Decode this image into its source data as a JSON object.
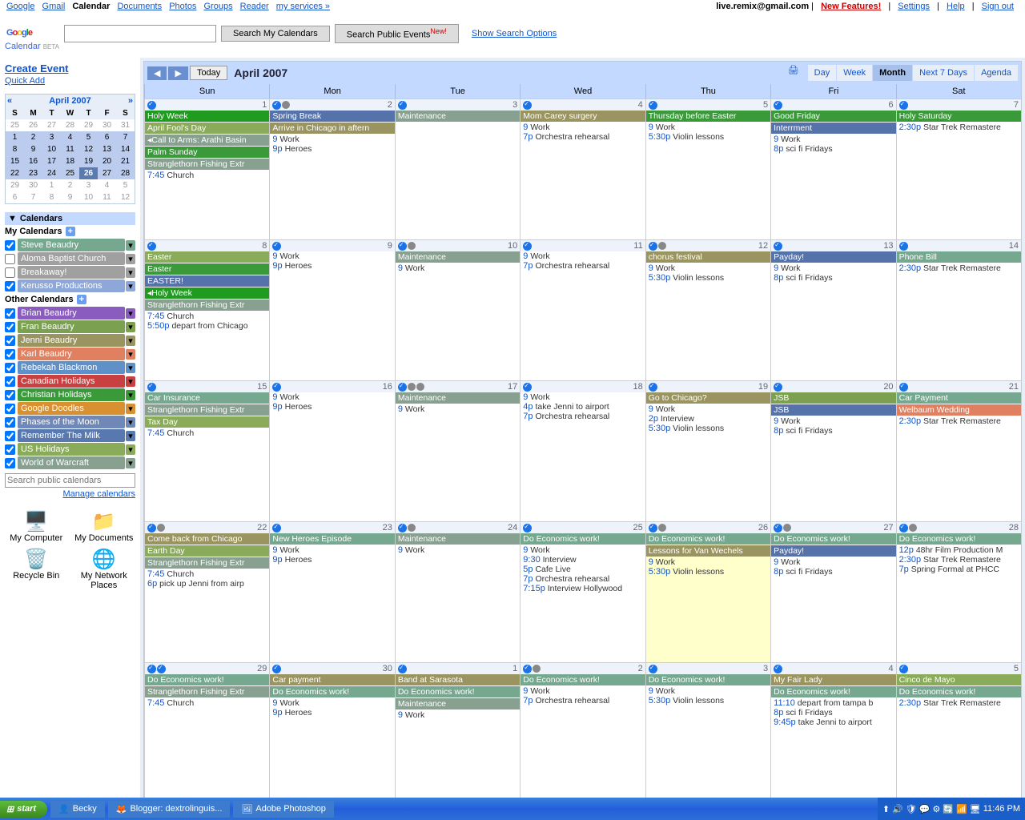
{
  "top_links": {
    "google": "Google",
    "gmail": "Gmail",
    "calendar": "Calendar",
    "documents": "Documents",
    "photos": "Photos",
    "groups": "Groups",
    "reader": "Reader",
    "more": "my services »"
  },
  "top_right": {
    "email": "live.remix@gmail.com",
    "new_features": "New Features!",
    "settings": "Settings",
    "help": "Help",
    "signout": "Sign out"
  },
  "logo_sub": "Calendar",
  "beta": "BETA",
  "search_my": "Search My Calendars",
  "search_public": "Search Public Events",
  "new_tag": "New!",
  "search_options": "Show Search Options",
  "create_event": "Create Event",
  "quick_add": "Quick Add",
  "mini": {
    "title": "April 2007",
    "dow": [
      "S",
      "M",
      "T",
      "W",
      "T",
      "F",
      "S"
    ],
    "rows": [
      [
        "25",
        "26",
        "27",
        "28",
        "29",
        "30",
        "31"
      ],
      [
        "1",
        "2",
        "3",
        "4",
        "5",
        "6",
        "7"
      ],
      [
        "8",
        "9",
        "10",
        "11",
        "12",
        "13",
        "14"
      ],
      [
        "15",
        "16",
        "17",
        "18",
        "19",
        "20",
        "21"
      ],
      [
        "22",
        "23",
        "24",
        "25",
        "26",
        "27",
        "28"
      ],
      [
        "29",
        "30",
        "1",
        "2",
        "3",
        "4",
        "5"
      ],
      [
        "6",
        "7",
        "8",
        "9",
        "10",
        "11",
        "12"
      ]
    ],
    "prev_other": [
      0
    ],
    "next_other": [
      5,
      6
    ],
    "today": [
      4,
      4
    ]
  },
  "calendars_hdr": "Calendars",
  "my_cal_hdr": "My Calendars",
  "my_cals": [
    {
      "label": "Steve Beaudry",
      "color": "#76a890",
      "checked": true
    },
    {
      "label": "Aloma Baptist Church",
      "color": "#a0a0a0",
      "checked": false
    },
    {
      "label": "Breakaway!",
      "color": "#a0a0a0",
      "checked": false
    },
    {
      "label": "Kerusso Productions",
      "color": "#8da8d8",
      "checked": true
    }
  ],
  "other_cal_hdr": "Other Calendars",
  "other_cals": [
    {
      "label": "Brian Beaudry",
      "color": "#8a5cc0",
      "checked": true
    },
    {
      "label": "Fran Beaudry",
      "color": "#7aa050",
      "checked": true
    },
    {
      "label": "Jenni Beaudry",
      "color": "#9a9560",
      "checked": true
    },
    {
      "label": "Karl Beaudry",
      "color": "#e08060",
      "checked": true
    },
    {
      "label": "Rebekah Blackmon",
      "color": "#6090c8",
      "checked": true
    },
    {
      "label": "Canadian Holidays",
      "color": "#c84040",
      "checked": true
    },
    {
      "label": "Christian Holidays",
      "color": "#3a9a3a",
      "checked": true
    },
    {
      "label": "Google Doodles",
      "color": "#d89030",
      "checked": true
    },
    {
      "label": "Phases of the Moon",
      "color": "#7088b8",
      "checked": true
    },
    {
      "label": "Remember The Milk",
      "color": "#5878b0",
      "checked": true
    },
    {
      "label": "US Holidays",
      "color": "#8aab5a",
      "checked": true
    },
    {
      "label": "World of Warcraft",
      "color": "#88a090",
      "checked": true
    }
  ],
  "search_placeholder": "Search public calendars",
  "manage": "Manage calendars",
  "desktop": {
    "mycomp": "My Computer",
    "mydocs": "My Documents",
    "recycle": "Recycle Bin",
    "netplaces": "My Network Places"
  },
  "toolbar": {
    "today": "Today",
    "title": "April 2007"
  },
  "views": {
    "day": "Day",
    "week": "Week",
    "month": "Month",
    "next7": "Next 7 Days",
    "agenda": "Agenda"
  },
  "dow": [
    "Sun",
    "Mon",
    "Tue",
    "Wed",
    "Thu",
    "Fri",
    "Sat"
  ],
  "weeks": [
    [
      {
        "n": "1",
        "icons": [
          "c"
        ],
        "evts": [
          {
            "t": "Holy Week",
            "c": "#1f9c1f",
            "span": 7
          },
          {
            "t": "April Fool's Day",
            "c": "#8aab5a"
          },
          {
            "t": "◂Call to Arms: Arathi Basin",
            "c": "#88a090"
          },
          {
            "t": "Palm Sunday",
            "c": "#3a9a3a"
          },
          {
            "t": "Stranglethorn Fishing Extr",
            "c": "#88a090"
          }
        ],
        "txts": [
          {
            "tm": "7:45",
            "t": "Church"
          }
        ]
      },
      {
        "n": "2",
        "icons": [
          "c",
          "m"
        ],
        "evts": [
          {
            "t": "Spring Break",
            "c": "#5572ab",
            "span": 5
          },
          {
            "t": "Arrive in Chicago in aftern",
            "c": "#9a9560"
          }
        ],
        "txts": [
          {
            "tm": "9",
            "t": "Work"
          },
          {
            "tm": "9p",
            "t": "Heroes"
          }
        ]
      },
      {
        "n": "3",
        "icons": [
          "c"
        ],
        "evts": [
          {
            "t": "Maintenance",
            "c": "#88a090"
          }
        ],
        "txts": []
      },
      {
        "n": "4",
        "icons": [
          "c"
        ],
        "evts": [
          {
            "t": "Mom Carey surgery",
            "c": "#9a9560"
          }
        ],
        "txts": [
          {
            "tm": "9",
            "t": "Work"
          },
          {
            "tm": "7p",
            "t": "Orchestra rehearsal"
          }
        ]
      },
      {
        "n": "5",
        "icons": [
          "c"
        ],
        "evts": [
          {
            "t": "Thursday before Easter",
            "c": "#3a9a3a"
          }
        ],
        "txts": [
          {
            "tm": "9",
            "t": "Work"
          },
          {
            "tm": "5:30p",
            "t": "Violin lessons"
          }
        ]
      },
      {
        "n": "6",
        "icons": [
          "c"
        ],
        "evts": [
          {
            "t": "Good Friday",
            "c": "#3a9a3a"
          },
          {
            "t": "Interrment",
            "c": "#5572ab"
          }
        ],
        "txts": [
          {
            "tm": "9",
            "t": "Work"
          },
          {
            "tm": "8p",
            "t": "sci fi Fridays"
          }
        ]
      },
      {
        "n": "7",
        "icons": [
          "c"
        ],
        "evts": [
          {
            "t": "Holy Saturday",
            "c": "#3a9a3a"
          }
        ],
        "txts": [
          {
            "tm": "2:30p",
            "t": "Star Trek Remastere"
          }
        ]
      }
    ],
    [
      {
        "n": "8",
        "icons": [
          "c"
        ],
        "evts": [
          {
            "t": "Easter",
            "c": "#8aab5a"
          },
          {
            "t": "Easter",
            "c": "#3a9a3a"
          },
          {
            "t": "EASTER!",
            "c": "#5572ab"
          },
          {
            "t": "◂Holy Week",
            "c": "#1f9c1f"
          },
          {
            "t": "Stranglethorn Fishing Extr",
            "c": "#88a090"
          }
        ],
        "txts": [
          {
            "tm": "7:45",
            "t": "Church"
          },
          {
            "tm": "5:50p",
            "t": "depart from Chicago"
          }
        ]
      },
      {
        "n": "9",
        "icons": [
          "c"
        ],
        "evts": [],
        "txts": [
          {
            "tm": "9",
            "t": "Work"
          },
          {
            "tm": "9p",
            "t": "Heroes"
          }
        ]
      },
      {
        "n": "10",
        "icons": [
          "c",
          "m"
        ],
        "evts": [
          {
            "t": "Maintenance",
            "c": "#88a090"
          }
        ],
        "txts": [
          {
            "tm": "9",
            "t": "Work"
          }
        ]
      },
      {
        "n": "11",
        "icons": [
          "c"
        ],
        "evts": [],
        "txts": [
          {
            "tm": "9",
            "t": "Work"
          },
          {
            "tm": "7p",
            "t": "Orchestra rehearsal"
          }
        ]
      },
      {
        "n": "12",
        "icons": [
          "c",
          "w"
        ],
        "evts": [
          {
            "t": "chorus festival",
            "c": "#9a9560"
          }
        ],
        "txts": [
          {
            "tm": "9",
            "t": "Work"
          },
          {
            "tm": "5:30p",
            "t": "Violin lessons"
          }
        ]
      },
      {
        "n": "13",
        "icons": [
          "c"
        ],
        "evts": [
          {
            "t": "Payday!",
            "c": "#5572ab"
          }
        ],
        "txts": [
          {
            "tm": "9",
            "t": "Work"
          },
          {
            "tm": "8p",
            "t": "sci fi Fridays"
          }
        ]
      },
      {
        "n": "14",
        "icons": [
          "c"
        ],
        "evts": [
          {
            "t": "Phone Bill",
            "c": "#76a890"
          }
        ],
        "txts": [
          {
            "tm": "2:30p",
            "t": "Star Trek Remastere"
          }
        ]
      }
    ],
    [
      {
        "n": "15",
        "icons": [
          "c"
        ],
        "evts": [
          {
            "t": "Car Insurance",
            "c": "#76a890"
          },
          {
            "t": "Stranglethorn Fishing Extr",
            "c": "#88a090"
          },
          {
            "t": "Tax Day",
            "c": "#8aab5a"
          }
        ],
        "txts": [
          {
            "tm": "7:45",
            "t": "Church"
          }
        ]
      },
      {
        "n": "16",
        "icons": [
          "c"
        ],
        "evts": [],
        "txts": [
          {
            "tm": "9",
            "t": "Work"
          },
          {
            "tm": "9p",
            "t": "Heroes"
          }
        ]
      },
      {
        "n": "17",
        "icons": [
          "c",
          "m",
          "m2"
        ],
        "evts": [
          {
            "t": "Maintenance",
            "c": "#88a090"
          }
        ],
        "txts": [
          {
            "tm": "9",
            "t": "Work"
          }
        ]
      },
      {
        "n": "18",
        "icons": [
          "c"
        ],
        "evts": [],
        "txts": [
          {
            "tm": "9",
            "t": "Work"
          },
          {
            "tm": "4p",
            "t": "take Jenni to airport"
          },
          {
            "tm": "7p",
            "t": "Orchestra rehearsal"
          }
        ]
      },
      {
        "n": "19",
        "icons": [
          "c"
        ],
        "evts": [
          {
            "t": "Go to Chicago?",
            "c": "#9a9560"
          }
        ],
        "txts": [
          {
            "tm": "9",
            "t": "Work"
          },
          {
            "tm": "2p",
            "t": "Interview"
          },
          {
            "tm": "5:30p",
            "t": "Violin lessons"
          }
        ]
      },
      {
        "n": "20",
        "icons": [
          "c"
        ],
        "evts": [
          {
            "t": "JSB",
            "c": "#7aa050"
          },
          {
            "t": "JSB",
            "c": "#5572ab"
          }
        ],
        "txts": [
          {
            "tm": "9",
            "t": "Work"
          },
          {
            "tm": "8p",
            "t": "sci fi Fridays"
          }
        ]
      },
      {
        "n": "21",
        "icons": [
          "c"
        ],
        "evts": [
          {
            "t": "Car Payment",
            "c": "#76a890"
          },
          {
            "t": "Welbaum Wedding",
            "c": "#e08060"
          }
        ],
        "txts": [
          {
            "tm": "2:30p",
            "t": "Star Trek Remastere"
          }
        ]
      }
    ],
    [
      {
        "n": "22",
        "icons": [
          "c",
          "d"
        ],
        "evts": [
          {
            "t": "Come back from Chicago",
            "c": "#9a9560"
          },
          {
            "t": "Earth Day",
            "c": "#8aab5a"
          },
          {
            "t": "Stranglethorn Fishing Extr",
            "c": "#88a090"
          }
        ],
        "txts": [
          {
            "tm": "7:45",
            "t": "Church"
          },
          {
            "tm": "6p",
            "t": "pick up Jenni from airp"
          }
        ]
      },
      {
        "n": "23",
        "icons": [
          "c"
        ],
        "evts": [
          {
            "t": "New Heroes Episode",
            "c": "#76a890"
          }
        ],
        "txts": [
          {
            "tm": "9",
            "t": "Work"
          },
          {
            "tm": "9p",
            "t": "Heroes"
          }
        ]
      },
      {
        "n": "24",
        "icons": [
          "c",
          "m"
        ],
        "evts": [
          {
            "t": "Maintenance",
            "c": "#88a090"
          }
        ],
        "txts": [
          {
            "tm": "9",
            "t": "Work"
          }
        ]
      },
      {
        "n": "25",
        "icons": [
          "c"
        ],
        "evts": [
          {
            "t": "Do Economics work!",
            "c": "#76a890"
          }
        ],
        "txts": [
          {
            "tm": "9",
            "t": "Work"
          },
          {
            "tm": "9:30",
            "t": "Interview"
          },
          {
            "tm": "5p",
            "t": "Cafe Live"
          },
          {
            "tm": "7p",
            "t": "Orchestra rehearsal"
          },
          {
            "tm": "7:15p",
            "t": "Interview Hollywood"
          }
        ]
      },
      {
        "n": "26",
        "today": true,
        "icons": [
          "c",
          "w"
        ],
        "evts": [
          {
            "t": "Do Economics work!",
            "c": "#76a890"
          },
          {
            "t": "Lessons for Van Wechels",
            "c": "#9a9560"
          }
        ],
        "txts": [
          {
            "tm": "9",
            "t": "Work"
          },
          {
            "tm": "5:30p",
            "t": "Violin lessons"
          }
        ]
      },
      {
        "n": "27",
        "icons": [
          "c",
          "w"
        ],
        "evts": [
          {
            "t": "Do Economics work!",
            "c": "#76a890"
          },
          {
            "t": "Payday!",
            "c": "#5572ab"
          }
        ],
        "txts": [
          {
            "tm": "9",
            "t": "Work"
          },
          {
            "tm": "8p",
            "t": "sci fi Fridays"
          }
        ]
      },
      {
        "n": "28",
        "icons": [
          "c",
          "w"
        ],
        "evts": [
          {
            "t": "Do Economics work!",
            "c": "#76a890"
          }
        ],
        "txts": [
          {
            "tm": "12p",
            "t": "48hr Film Production M"
          },
          {
            "tm": "2:30p",
            "t": "Star Trek Remastere"
          },
          {
            "tm": "7p",
            "t": "Spring Formal at PHCC"
          }
        ]
      }
    ],
    [
      {
        "n": "29",
        "icons": [
          "c",
          "c"
        ],
        "evts": [
          {
            "t": "Do Economics work!",
            "c": "#76a890"
          },
          {
            "t": "Stranglethorn Fishing Extr",
            "c": "#88a090"
          }
        ],
        "txts": [
          {
            "tm": "7:45",
            "t": "Church"
          }
        ]
      },
      {
        "n": "30",
        "icons": [
          "c"
        ],
        "evts": [
          {
            "t": "Car payment",
            "c": "#9a9560"
          },
          {
            "t": "Do Economics work!",
            "c": "#76a890"
          }
        ],
        "txts": [
          {
            "tm": "9",
            "t": "Work"
          },
          {
            "tm": "9p",
            "t": "Heroes"
          }
        ]
      },
      {
        "n": "1",
        "icons": [
          "c"
        ],
        "evts": [
          {
            "t": "Band at Sarasota",
            "c": "#9a9560"
          },
          {
            "t": "Do Economics work!",
            "c": "#76a890"
          },
          {
            "t": "Maintenance",
            "c": "#88a090"
          }
        ],
        "txts": [
          {
            "tm": "9",
            "t": "Work"
          }
        ]
      },
      {
        "n": "2",
        "icons": [
          "c",
          "m"
        ],
        "evts": [
          {
            "t": "Do Economics work!",
            "c": "#76a890"
          }
        ],
        "txts": [
          {
            "tm": "9",
            "t": "Work"
          },
          {
            "tm": "7p",
            "t": "Orchestra rehearsal"
          }
        ]
      },
      {
        "n": "3",
        "icons": [
          "c"
        ],
        "evts": [
          {
            "t": "Do Economics work!",
            "c": "#76a890"
          }
        ],
        "txts": [
          {
            "tm": "9",
            "t": "Work"
          },
          {
            "tm": "5:30p",
            "t": "Violin lessons"
          }
        ]
      },
      {
        "n": "4",
        "icons": [
          "c"
        ],
        "evts": [
          {
            "t": "My Fair Lady",
            "c": "#9a9560"
          },
          {
            "t": "Do Economics work!",
            "c": "#76a890"
          }
        ],
        "txts": [
          {
            "tm": "11:10",
            "t": "depart from tampa b"
          },
          {
            "tm": "8p",
            "t": "sci fi Fridays"
          },
          {
            "tm": "9:45p",
            "t": "take Jenni to airport"
          }
        ]
      },
      {
        "n": "5",
        "icons": [
          "c"
        ],
        "evts": [
          {
            "t": "Cinco de Mayo",
            "c": "#8aab5a"
          },
          {
            "t": "Do Economics work!",
            "c": "#76a890"
          }
        ],
        "txts": [
          {
            "tm": "2:30p",
            "t": "Star Trek Remastere"
          }
        ]
      }
    ],
    []
  ],
  "taskbar": {
    "start": "start",
    "items": [
      {
        "ico": "👤",
        "t": "Becky"
      },
      {
        "ico": "🦊",
        "t": "Blogger: dextrolinguis..."
      },
      {
        "ico": "🖼",
        "t": "Adobe Photoshop"
      }
    ],
    "time": "11:46 PM"
  }
}
